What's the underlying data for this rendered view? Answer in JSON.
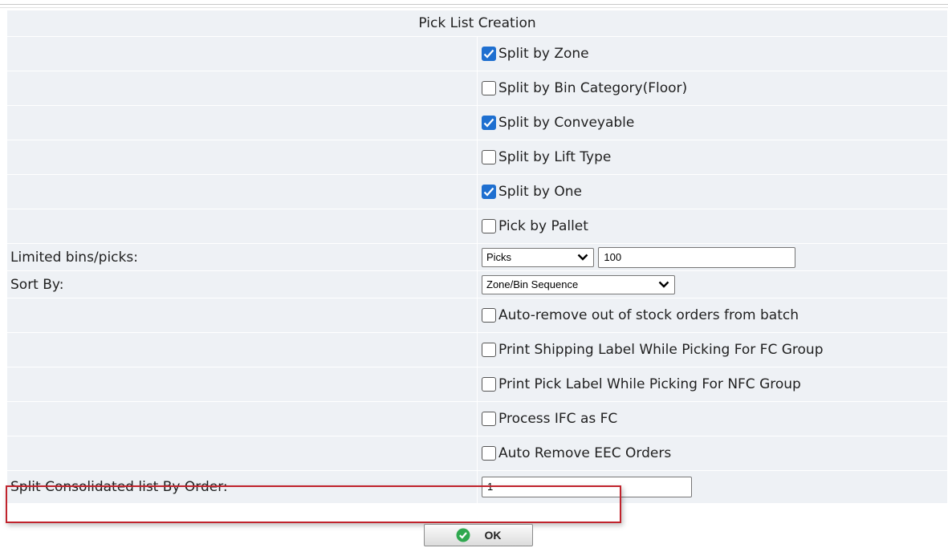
{
  "title": "Pick List Creation",
  "split_options": [
    {
      "label": "Split by Zone",
      "checked": true
    },
    {
      "label": "Split by Bin Category(Floor)",
      "checked": false
    },
    {
      "label": "Split by Conveyable",
      "checked": true
    },
    {
      "label": "Split by Lift Type",
      "checked": false
    },
    {
      "label": "Split by One",
      "checked": true
    },
    {
      "label": "Pick by Pallet",
      "checked": false
    }
  ],
  "limited": {
    "label": "Limited bins/picks:",
    "select_value": "Picks",
    "input_value": "100"
  },
  "sort_by": {
    "label": "Sort By:",
    "select_value": "Zone/Bin Sequence"
  },
  "other_options": [
    {
      "label": "Auto-remove out of stock orders from batch",
      "checked": false
    },
    {
      "label": "Print Shipping Label While Picking For FC Group",
      "checked": false
    },
    {
      "label": "Print Pick Label While Picking For NFC Group",
      "checked": false
    },
    {
      "label": "Process IFC as FC",
      "checked": false
    },
    {
      "label": "Auto Remove EEC Orders",
      "checked": false
    }
  ],
  "split_consolidated": {
    "label": "Split Consolidated list By Order:",
    "input_value": "1"
  },
  "ok_button": {
    "label": "OK"
  },
  "colors": {
    "row_bg": "#eef1f5",
    "checkbox_checked": "#1e6fd0",
    "highlight_border": "#c0232c",
    "ok_icon": "#2fa84f"
  }
}
